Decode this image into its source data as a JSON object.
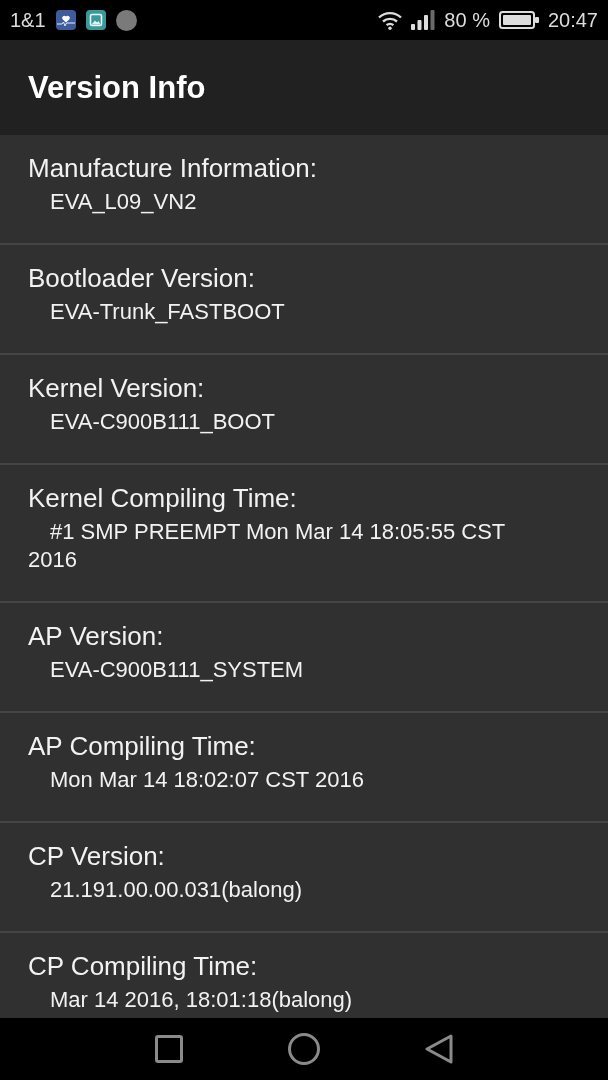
{
  "status_bar": {
    "carrier": "1&1",
    "battery_percent": "80 %",
    "time": "20:47"
  },
  "app_bar": {
    "title": "Version Info"
  },
  "items": [
    {
      "label": "Manufacture Information:",
      "value": "EVA_L09_VN2"
    },
    {
      "label": "Bootloader Version:",
      "value": "EVA-Trunk_FASTBOOT"
    },
    {
      "label": "Kernel Version:",
      "value": "EVA-C900B111_BOOT"
    },
    {
      "label": "Kernel Compiling Time:",
      "value": "#1 SMP PREEMPT Mon Mar 14 18:05:55 CST 2016"
    },
    {
      "label": "AP Version:",
      "value": "EVA-C900B111_SYSTEM"
    },
    {
      "label": "AP Compiling Time:",
      "value": "Mon Mar 14 18:02:07 CST 2016"
    },
    {
      "label": "CP Version:",
      "value": "21.191.00.00.031(balong)"
    },
    {
      "label": "CP Compiling Time:",
      "value": "Mar 14 2016, 18:01:18(balong)"
    }
  ]
}
